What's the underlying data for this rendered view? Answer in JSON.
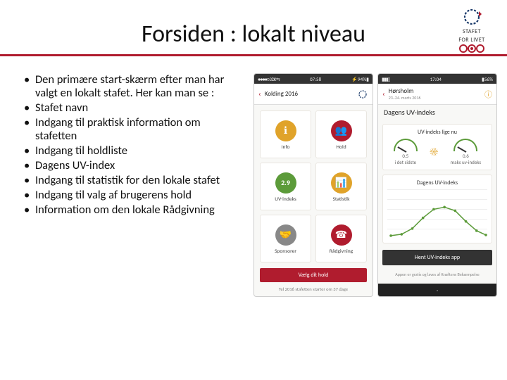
{
  "title": "Forsiden : lokalt niveau",
  "logo": {
    "line1": "STAFET",
    "line2": "FOR LIVET"
  },
  "bullets": [
    "Den primære start-skærm efter man har valgt en lokalt stafet. Her kan man se :",
    "Stafet navn",
    "Indgang til praktisk information om stafetten",
    "Indgang til holdliste",
    "Dagens UV-index",
    "Indgang til statistik for den lokale stafet",
    "Indgang til valg af brugerens hold",
    "Information om den lokale Rådgivning"
  ],
  "phone1": {
    "status_time": "07:58",
    "carrier": "3 DK",
    "appbar_title": "Kolding 2016",
    "tiles": [
      {
        "label": "Info",
        "icon": "ℹ",
        "color": "ic-yellow"
      },
      {
        "label": "Hold",
        "icon": "👥",
        "color": "ic-red"
      },
      {
        "label": "UV-indeks",
        "icon": "2.9",
        "color": "ic-green"
      },
      {
        "label": "Statistik",
        "icon": "📊",
        "color": "ic-yellow"
      },
      {
        "label": "Sponsorer",
        "icon": "🤝",
        "color": "ic-gray"
      },
      {
        "label": "Rådgivning",
        "icon": "☎",
        "color": "ic-red"
      }
    ],
    "choose_team": "Vælg dit hold",
    "countdown": "Tel 2016 stafetten starter om 37 dage"
  },
  "phone2": {
    "status_time": "17:04",
    "appbar_title": "Hørsholm",
    "appbar_date": "23.-24. marts 2016",
    "page_heading": "Dagens UV-indeks",
    "card1_title": "UV-indeks lige nu",
    "uv_now": "0.5",
    "uv_max": "0.6",
    "uv_now_label": "i det sidste",
    "uv_max_label": "maks uv-indeks",
    "card2_title": "Dagens UV-indeks",
    "download": "Hent UV-indeks app",
    "footer": "Appen er gratis og laves af Kræftens Bekæmpelse"
  }
}
